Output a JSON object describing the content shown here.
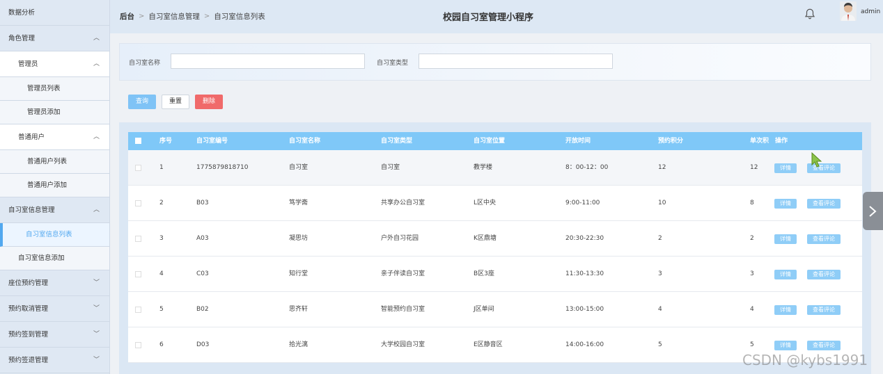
{
  "sidebar": {
    "items": [
      {
        "label": "数据分析"
      },
      {
        "label": "角色管理",
        "chevron": "^"
      },
      {
        "label": "管理员",
        "chevron": "^"
      },
      {
        "label": "管理员列表"
      },
      {
        "label": "管理员添加"
      },
      {
        "label": "普通用户",
        "chevron": "^"
      },
      {
        "label": "普通用户列表"
      },
      {
        "label": "普通用户添加"
      },
      {
        "label": "自习室信息管理",
        "chevron": "^"
      },
      {
        "label": "自习室信息列表"
      },
      {
        "label": "自习室信息添加"
      },
      {
        "label": "座位预约管理",
        "chevron": "v"
      },
      {
        "label": "预约取消管理",
        "chevron": "v"
      },
      {
        "label": "预约签到管理",
        "chevron": "v"
      },
      {
        "label": "预约签退管理",
        "chevron": "v"
      }
    ]
  },
  "header": {
    "breadcrumb": [
      "后台",
      "自习室信息管理",
      "自习室信息列表"
    ],
    "sep": ">",
    "title": "校园自习室管理小程序",
    "username": "admin"
  },
  "search": {
    "name_label": "自习室名称",
    "name_value": "",
    "type_label": "自习室类型",
    "type_value": ""
  },
  "actions": {
    "query": "查询",
    "reset": "重置",
    "delete": "删除"
  },
  "table": {
    "headers": [
      "序号",
      "自习室编号",
      "自习室名称",
      "自习室类型",
      "自习室位置",
      "开放时间",
      "预约积分",
      "单次积",
      "操作"
    ],
    "op_detail": "详情",
    "op_review": "查看评论",
    "rows": [
      {
        "idx": "1",
        "code": "1775879818710",
        "name": "自习室",
        "type": "自习室",
        "loc": "教学楼",
        "time": "8：00-12：00",
        "points": "12",
        "single": "12"
      },
      {
        "idx": "2",
        "code": "B03",
        "name": "笃学斋",
        "type": "共享办公自习室",
        "loc": "L区中央",
        "time": "9:00-11:00",
        "points": "10",
        "single": "8"
      },
      {
        "idx": "3",
        "code": "A03",
        "name": "凝思坊",
        "type": "户外自习花园",
        "loc": "K区鼎塘",
        "time": "20:30-22:30",
        "points": "2",
        "single": "2"
      },
      {
        "idx": "4",
        "code": "C03",
        "name": "知行堂",
        "type": "亲子伴读自习室",
        "loc": "B区3座",
        "time": "11:30-13:30",
        "points": "3",
        "single": "3"
      },
      {
        "idx": "5",
        "code": "B02",
        "name": "思齐轩",
        "type": "智能预约自习室",
        "loc": "J区单间",
        "time": "13:00-15:00",
        "points": "4",
        "single": "4"
      },
      {
        "idx": "6",
        "code": "D03",
        "name": "拾光漓",
        "type": "大学校园自习室",
        "loc": "E区静音区",
        "time": "14:00-16:00",
        "points": "5",
        "single": "5"
      }
    ]
  },
  "watermark": "CSDN @kybs1991",
  "icons": {
    "bell": "bell-icon",
    "next": "chevron-right-icon"
  },
  "colors": {
    "accent": "#7fc8f8",
    "danger": "#f06a6a",
    "active_text": "#52a8ef"
  }
}
